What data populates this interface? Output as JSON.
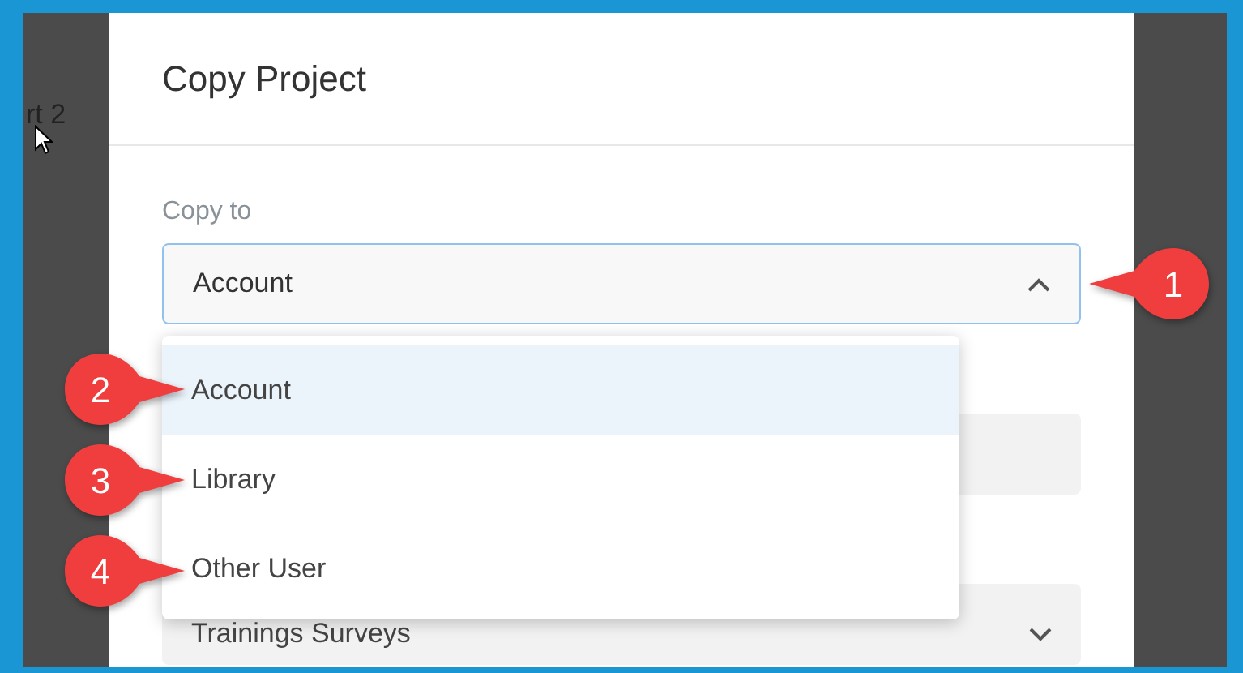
{
  "background": {
    "row_text": "rt 2"
  },
  "dialog": {
    "title": "Copy Project",
    "copy_to": {
      "label": "Copy to",
      "value": "Account",
      "expanded": true,
      "callout": "1",
      "options": [
        {
          "label": "Account",
          "selected": true,
          "callout": "2"
        },
        {
          "label": "Library",
          "selected": false,
          "callout": "3"
        },
        {
          "label": "Other User",
          "selected": false,
          "callout": "4"
        }
      ]
    },
    "fields": [
      {
        "kind": "blank"
      },
      {
        "kind": "select",
        "value": "Trainings Surveys"
      }
    ]
  }
}
